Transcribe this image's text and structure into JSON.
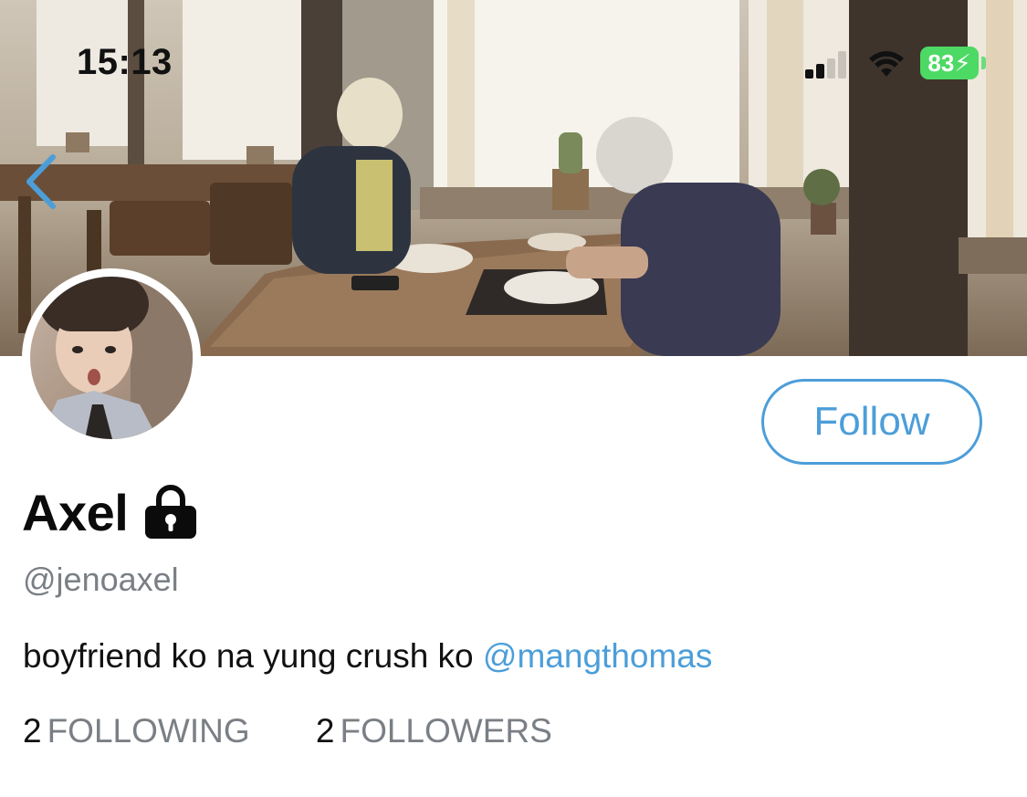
{
  "status_bar": {
    "time": "15:13",
    "battery": "83"
  },
  "profile": {
    "display_name": "Axel",
    "handle": "@jenoaxel",
    "bio_text": "boyfriend ko na yung crush ko ",
    "bio_mention": "@mangthomas",
    "follow_label": "Follow",
    "following_count": "2",
    "following_label": "FOLLOWING",
    "followers_count": "2",
    "followers_label": "FOLLOWERS"
  },
  "icons": [
    "back-chevron-icon",
    "lock-icon",
    "cellular-signal-icon",
    "wifi-icon",
    "charging-bolt-icon"
  ],
  "colors": {
    "accent": "#4c9ed9",
    "secondary_text": "#7a7f85",
    "battery": "#4cd964"
  }
}
